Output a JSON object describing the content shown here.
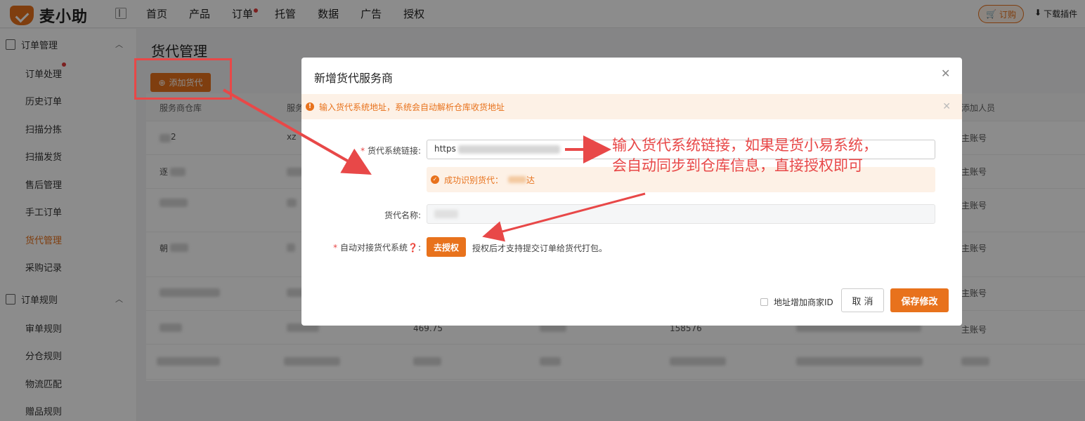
{
  "header": {
    "logo_text": "麦小助",
    "nav": [
      "首页",
      "产品",
      "订单",
      "托管",
      "数据",
      "广告",
      "授权"
    ],
    "order_button": "订购",
    "download_plugin": "下载插件"
  },
  "sidebar": {
    "group1": {
      "label": "订单管理",
      "items": [
        "订单处理",
        "历史订单",
        "扫描分拣",
        "扫描发货",
        "售后管理",
        "手工订单",
        "货代管理",
        "采购记录"
      ]
    },
    "group2": {
      "label": "订单规则",
      "items": [
        "审单规则",
        "分仓规则",
        "物流匹配",
        "赠品规则"
      ]
    },
    "active_item": "货代管理"
  },
  "main": {
    "title": "货代管理",
    "add_button": "添加货代",
    "columns": [
      "服务商仓库",
      "服务",
      "添加人员"
    ],
    "rows": [
      {
        "c1": "2",
        "c2": "xz",
        "c_last": "主账号"
      },
      {
        "c1": "逐",
        "c2": "",
        "c_last": "主账号"
      },
      {
        "c1": "",
        "c2": "",
        "c_last": "主账号"
      },
      {
        "c1": "朝",
        "c2": "",
        "c_last": "主账号"
      },
      {
        "c1": "",
        "c2": "",
        "c_last": "主账号"
      },
      {
        "c1": "",
        "c2": "",
        "c_last": "主账号"
      },
      {
        "c1": "",
        "c2": "",
        "c_last": ""
      }
    ],
    "partial_values": [
      "469.75",
      "158576"
    ]
  },
  "modal": {
    "title": "新增货代服务商",
    "alert": "输入货代系统地址，系统会自动解析仓库收货地址",
    "field_link_label": "货代系统链接:",
    "field_link_value": "https",
    "success_text": "成功识别货代：",
    "success_suffix": "达",
    "field_name_label": "货代名称:",
    "field_auto_label": "自动对接货代系统",
    "auth_button": "去授权",
    "auth_hint": "授权后才支持提交订单给货代打包。",
    "checkbox_label": "地址增加商家ID",
    "cancel_button": "取 消",
    "save_button": "保存修改"
  },
  "annotation": {
    "line1": "输入货代系统链接，如果是货小易系统，",
    "line2": "会自动同步到仓库信息，直接授权即可"
  },
  "colors": {
    "accent": "#e8721c",
    "annotation": "#e84848"
  }
}
